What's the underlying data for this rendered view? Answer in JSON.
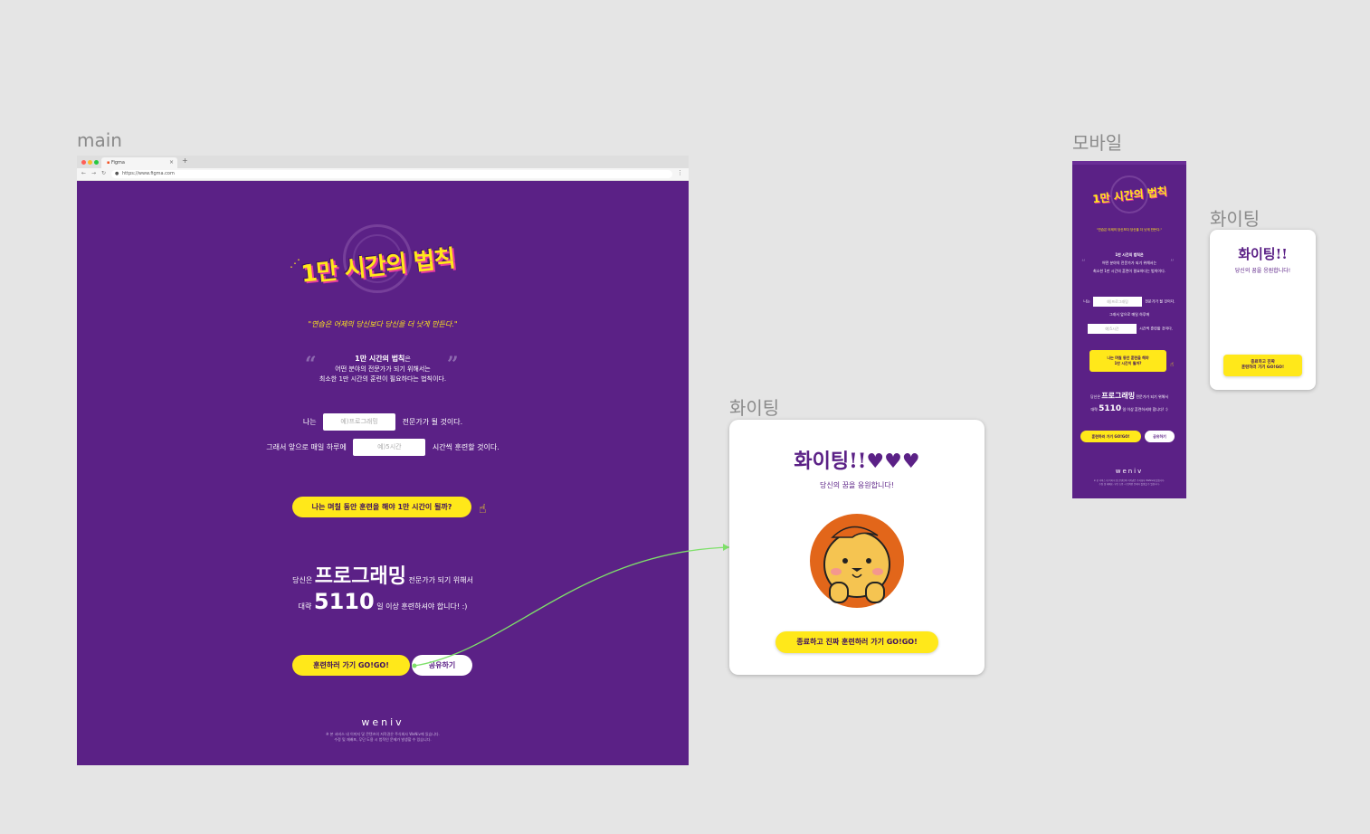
{
  "labels": {
    "main": "main",
    "mobile": "모바일",
    "fighting_large": "화이팅",
    "fighting_small": "화이팅"
  },
  "browser": {
    "tab_title": "Figma",
    "url": "https://www.figma.com"
  },
  "main": {
    "title": "1만 시간의 법칙",
    "quote": "\"연습은 어제의 당신보다 당신을 더 낫게 만든다.\"",
    "desc_title": "1만 시간의 법칙",
    "desc_title_suffix": "은",
    "desc_line1": "어떤 분야의 전문가가 되기 위해서는",
    "desc_line2": "최소한 1만 시간의 훈련이 필요하다는 법칙이다.",
    "row1_prefix": "나는",
    "row1_placeholder": "예)프로그래밍",
    "row1_suffix": "전문가가 될 것이다.",
    "row2_prefix": "그래서 앞으로 매일 하루에",
    "row2_placeholder": "예)5시간",
    "row2_suffix": "시간씩 훈련할 것이다.",
    "cta": "나는 며칠 동안 훈련을 해야 1만 시간이 될까?",
    "result_prefix": "당신은",
    "result_field": "프로그래밍",
    "result_suffix": "전문가가 되기 위해서",
    "result2_prefix": "대략",
    "result_days": "5110",
    "result2_suffix": "일 이상 훈련하셔야 합니다! :)",
    "btn_go": "훈련하러 가기 GO!GO!",
    "btn_share": "공유하기",
    "brand": "weniv",
    "copyright1": "※ 본 서비스 내 이미지 및 콘텐츠의 저작권은 주식회사 WeNiv에 있습니다.",
    "copyright2": "수정 및 재배포, 무단 도용 시 법적인 문제가 발생할 수 있습니다."
  },
  "popup_large": {
    "title": "화이팅!!♥♥♥",
    "subtitle": "당신의 꿈을 응원합니다!",
    "button": "종료하고 진짜 훈련하러 가기 GO!GO!"
  },
  "mobile": {
    "title": "1만 시간의 법칙",
    "quote": "\"연습은 어제의 당신보다 당신을 더 낫게 만든다.\"",
    "desc_title": "1만 시간의 법칙은",
    "desc_line1": "어떤 분야의 전문가가 되기 위해서는",
    "desc_line2": "최소한 1만 시간의 훈련이 필요하다는 법칙이다.",
    "row1_prefix": "나는",
    "row1_placeholder": "예)프로그래밍",
    "row1_suffix": "전문가가 될 것이다.",
    "row2_text": "그래서 앞으로 매일 하루에",
    "row3_placeholder": "예)5시간",
    "row3_suffix": "시간씩 훈련할 것이다.",
    "cta_line1": "나는 며칠 동안 훈련을 해야",
    "cta_line2": "1만 시간이 될까?",
    "result_prefix": "당신은",
    "result_field": "프로그래밍",
    "result_suffix": "전문가가 되기 위해서",
    "result2_prefix": "대략",
    "result_days": "5110",
    "result2_suffix": "일 이상 훈련하셔야 합니다! :)",
    "btn_go": "훈련하러 가기 GO!GO!",
    "btn_share": "공유하기",
    "brand": "weniv",
    "copyright1": "※ 본 서비스 내 이미지 및 콘텐츠의 저작권은 주식회사 WeNiv에 있습니다.",
    "copyright2": "수정 및 재배포, 무단 도용 시 법적인 문제가 발생할 수 있습니다."
  },
  "popup_small": {
    "title": "화이팅!!",
    "subtitle": "당신의 꿈을 응원합니다!",
    "button_line1": "종료하고 진짜",
    "button_line2": "훈련하러 가기 GO!GO!"
  },
  "colors": {
    "purple": "#5b2186",
    "yellow": "#ffe81a",
    "canvas": "#e5e5e5",
    "connector": "#7ee06a"
  }
}
